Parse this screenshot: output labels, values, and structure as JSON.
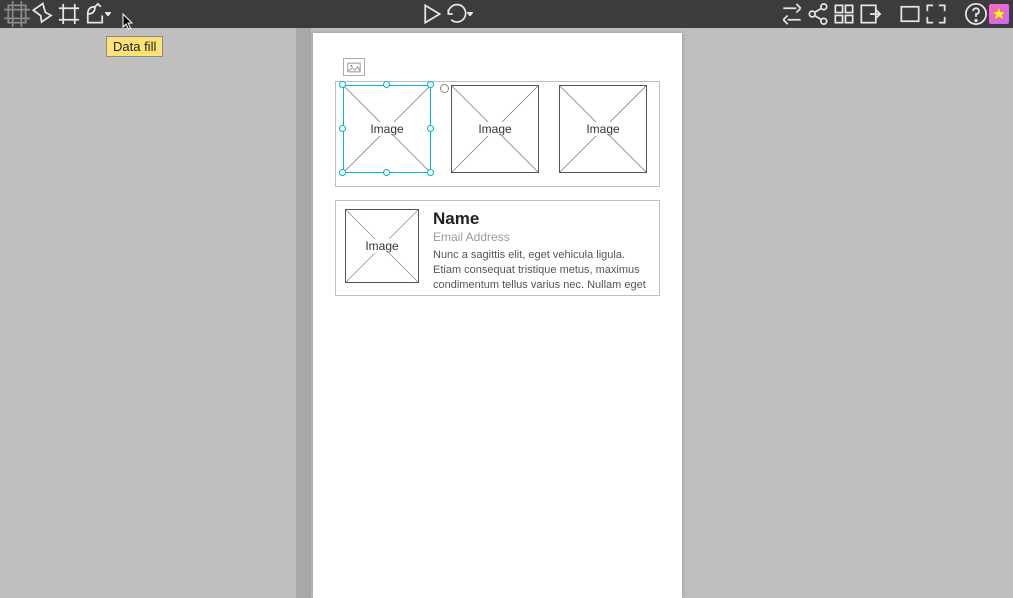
{
  "tooltip": {
    "datafill": "Data fill"
  },
  "placeholders": {
    "label": "Image"
  },
  "card": {
    "name": "Name",
    "email": "Email Address",
    "body": "Nunc a sagittis elit, eget vehicula ligula. Etiam consequat tristique metus, maximus condimentum tellus varius nec. Nullam eget"
  }
}
